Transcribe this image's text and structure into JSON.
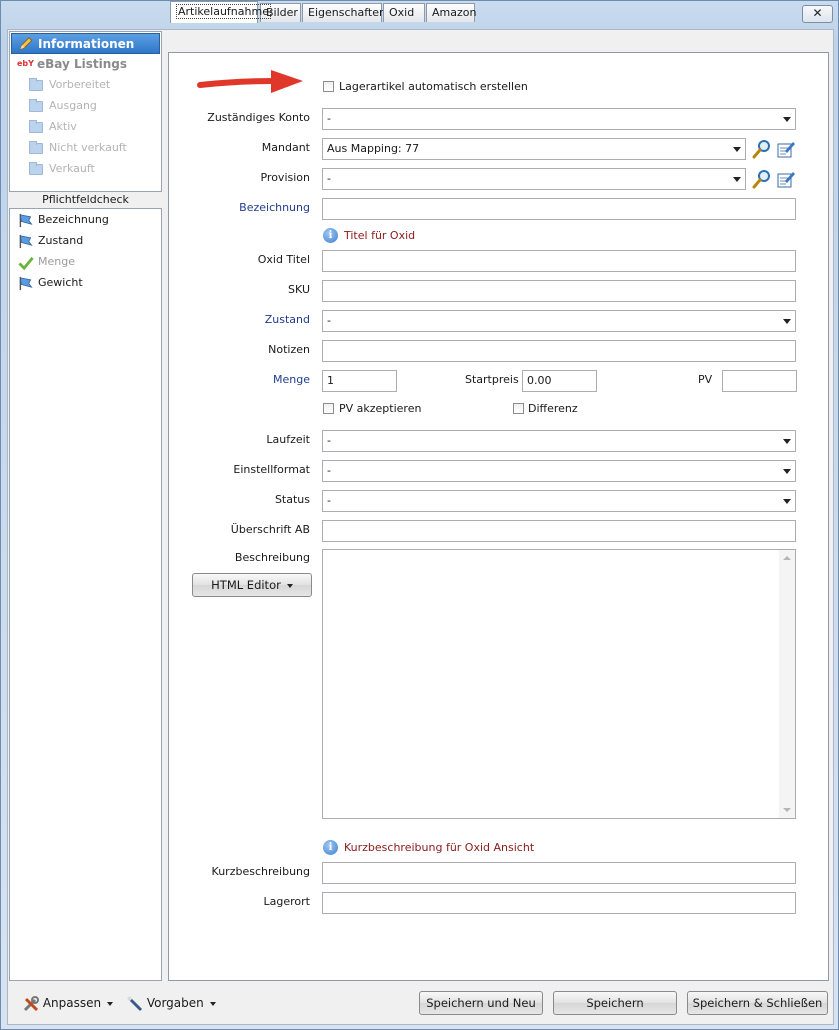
{
  "window": {
    "close_label": "✕"
  },
  "sidebar": {
    "selected": "Informationen",
    "header": "eBay Listings",
    "header_badge": "ebY",
    "items": [
      "Vorbereitet",
      "Ausgang",
      "Aktiv",
      "Nicht verkauft",
      "Verkauft"
    ]
  },
  "pflichtfeldcheck": {
    "title": "Pflichtfeldcheck",
    "items": [
      {
        "label": "Bezeichnung",
        "status": "flag"
      },
      {
        "label": "Zustand",
        "status": "flag"
      },
      {
        "label": "Menge",
        "status": "check"
      },
      {
        "label": "Gewicht",
        "status": "flag"
      }
    ]
  },
  "tabs": [
    "Artikelaufnahme",
    "Bilder",
    "Eigenschaften",
    "Oxid",
    "Amazon"
  ],
  "form": {
    "lagerartikel_label": "Lagerartikel automatisch erstellen",
    "zustaendiges_konto": {
      "label": "Zuständiges Konto",
      "value": "-"
    },
    "mandant": {
      "label": "Mandant",
      "value": "Aus Mapping: 77"
    },
    "provision": {
      "label": "Provision",
      "value": "-"
    },
    "bezeichnung": {
      "label": "Bezeichnung",
      "value": ""
    },
    "titel_info": "Titel für Oxid",
    "oxid_titel": {
      "label": "Oxid Titel",
      "value": ""
    },
    "sku": {
      "label": "SKU",
      "value": ""
    },
    "zustand": {
      "label": "Zustand",
      "value": "-"
    },
    "notizen": {
      "label": "Notizen",
      "value": ""
    },
    "menge": {
      "label": "Menge",
      "value": "1"
    },
    "startpreis": {
      "label": "Startpreis",
      "value": "0.00"
    },
    "pv": {
      "label": "PV",
      "value": ""
    },
    "pv_akzeptieren": "PV akzeptieren",
    "differenz": "Differenz",
    "laufzeit": {
      "label": "Laufzeit",
      "value": "-"
    },
    "einstellformat": {
      "label": "Einstellformat",
      "value": "-"
    },
    "status": {
      "label": "Status",
      "value": "-"
    },
    "ueberschrift": {
      "label": "Überschrift AB",
      "value": ""
    },
    "beschreibung": {
      "label": "Beschreibung"
    },
    "html_editor": "HTML Editor",
    "kurz_info": "Kurzbeschreibung für Oxid Ansicht",
    "kurzbeschreibung": {
      "label": "Kurzbeschreibung",
      "value": ""
    },
    "lagerort": {
      "label": "Lagerort",
      "value": ""
    }
  },
  "footer": {
    "anpassen": "Anpassen",
    "vorgaben": "Vorgaben",
    "speichern_neu": "Speichern und Neu",
    "speichern": "Speichern",
    "speichern_schliessen": "Speichern & Schließen"
  },
  "colors": {
    "selected_nav": "#2e77c9",
    "info_text": "#8b1a1a",
    "blue_label": "#1f3d8f",
    "arrow": "#e0372b"
  }
}
